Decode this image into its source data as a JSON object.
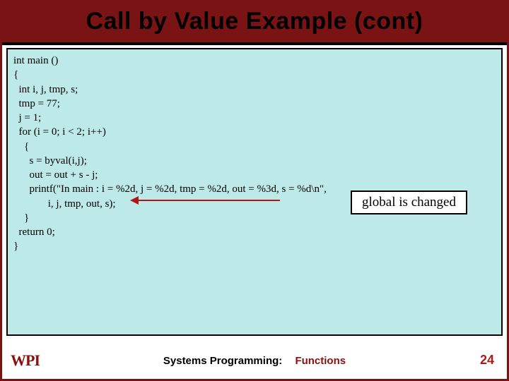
{
  "title": "Call by Value Example (cont)",
  "code": {
    "l1": "int main ()",
    "l2": "{",
    "l3": "  int i, j, tmp, s;",
    "l4": "",
    "l5": "  tmp = 77;",
    "l6": "  j = 1;",
    "l7": "",
    "l8": "  for (i = 0; i < 2; i++)",
    "l9": "    {",
    "l10": "      s = byval(i,j);",
    "l11": "      out = out + s - j;",
    "l12": "      printf(\"In main : i = %2d, j = %2d, tmp = %2d, out = %3d, s = %d\\n\",",
    "l13": "             i, j, tmp, out, s);",
    "l14": "    }",
    "l15": "  return 0;",
    "l16": "}"
  },
  "annotation": "global is changed",
  "footer": {
    "logo": "WPI",
    "center_left": "Systems Programming:",
    "center_right": "Functions",
    "page": "24"
  }
}
